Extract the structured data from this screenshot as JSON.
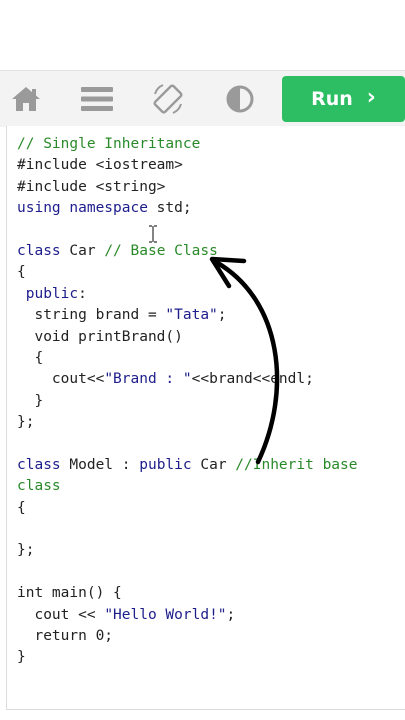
{
  "toolbar": {
    "icons": [
      "home-icon",
      "menu-icon",
      "rotate-screen-icon",
      "contrast-icon"
    ],
    "run_label": "Run",
    "run_color": "#2dbe63"
  },
  "editor": {
    "lines": [
      [
        {
          "t": "// Single Inheritance",
          "c": "cm"
        }
      ],
      [
        {
          "t": "#include <iostream>",
          "c": ""
        }
      ],
      [
        {
          "t": "#include <string>",
          "c": ""
        }
      ],
      [
        {
          "t": "using namespace",
          "c": "kw"
        },
        {
          "t": " std;",
          "c": ""
        }
      ],
      [
        {
          "t": "",
          "c": ""
        }
      ],
      [
        {
          "t": "class",
          "c": "kw"
        },
        {
          "t": " Car ",
          "c": ""
        },
        {
          "t": "// Base Class",
          "c": "cm"
        }
      ],
      [
        {
          "t": "{",
          "c": ""
        }
      ],
      [
        {
          "t": " public",
          "c": "kw"
        },
        {
          "t": ":",
          "c": ""
        }
      ],
      [
        {
          "t": "  string brand = ",
          "c": ""
        },
        {
          "t": "\"Tata\"",
          "c": "str"
        },
        {
          "t": ";",
          "c": ""
        }
      ],
      [
        {
          "t": "  void printBrand()",
          "c": ""
        }
      ],
      [
        {
          "t": "  {",
          "c": ""
        }
      ],
      [
        {
          "t": "    cout<<",
          "c": ""
        },
        {
          "t": "\"Brand : \"",
          "c": "str"
        },
        {
          "t": "<<brand<<endl;",
          "c": ""
        }
      ],
      [
        {
          "t": "  }",
          "c": ""
        }
      ],
      [
        {
          "t": "};",
          "c": ""
        }
      ],
      [
        {
          "t": "",
          "c": ""
        }
      ],
      [
        {
          "t": "class",
          "c": "kw"
        },
        {
          "t": " Model : ",
          "c": ""
        },
        {
          "t": "public",
          "c": "kw"
        },
        {
          "t": " Car ",
          "c": ""
        },
        {
          "t": "//Inherit base",
          "c": "cm"
        }
      ],
      [
        {
          "t": "class",
          "c": "cm"
        }
      ],
      [
        {
          "t": "{",
          "c": ""
        }
      ],
      [
        {
          "t": "",
          "c": ""
        }
      ],
      [
        {
          "t": "};",
          "c": ""
        }
      ],
      [
        {
          "t": "",
          "c": ""
        }
      ],
      [
        {
          "t": "int main() {",
          "c": ""
        }
      ],
      [
        {
          "t": "  cout << ",
          "c": ""
        },
        {
          "t": "\"Hello World!\"",
          "c": "str"
        },
        {
          "t": ";",
          "c": ""
        }
      ],
      [
        {
          "t": "  return 0;",
          "c": ""
        }
      ],
      [
        {
          "t": "}",
          "c": ""
        }
      ]
    ]
  },
  "annotation": {
    "icon": "curved-arrow-icon"
  }
}
